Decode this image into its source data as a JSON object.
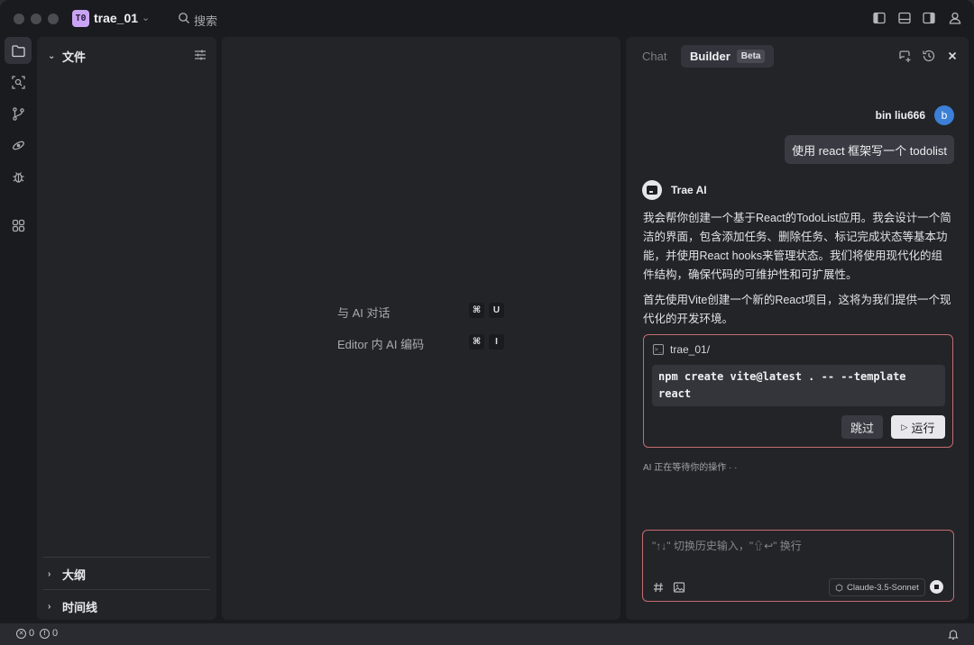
{
  "titlebar": {
    "project_badge": "T0",
    "project_name": "trae_01",
    "search_label": "搜索"
  },
  "activity_bar": {
    "items": [
      {
        "icon": "files-icon",
        "active": true
      },
      {
        "icon": "search-scan-icon",
        "active": false
      },
      {
        "icon": "source-control-icon",
        "active": false
      },
      {
        "icon": "remote-icon",
        "active": false
      },
      {
        "icon": "debug-icon",
        "active": false
      },
      {
        "icon": "extensions-icon",
        "active": false
      }
    ]
  },
  "files_panel": {
    "title": "文件",
    "outline_title": "大纲",
    "timeline_title": "时间线"
  },
  "editor": {
    "hints": [
      {
        "label": "与 AI 对话",
        "keys": [
          "⌘",
          "U"
        ]
      },
      {
        "label": "Editor 内 AI 编码",
        "keys": [
          "⌘",
          "I"
        ]
      }
    ]
  },
  "chat": {
    "tabs": {
      "chat": "Chat",
      "builder": "Builder",
      "beta": "Beta"
    },
    "user": {
      "name": "bin liu666",
      "avatar_letter": "b",
      "message": "使用 react 框架写一个 todolist"
    },
    "ai": {
      "name": "Trae AI",
      "paragraph1": "我会帮你创建一个基于React的TodoList应用。我会设计一个简洁的界面，包含添加任务、删除任务、标记完成状态等基本功能，并使用React hooks来管理状态。我们将使用现代化的组件结构，确保代码的可维护性和可扩展性。",
      "paragraph2": "首先使用Vite创建一个新的React项目，这将为我们提供一个现代化的开发环境。"
    },
    "command": {
      "path": "trae_01/",
      "line1": "npm create vite@latest . -- --template",
      "line2": "react",
      "skip_label": "跳过",
      "run_label": "运行"
    },
    "waiting_text": "AI 正在等待你的操作 · ·",
    "input": {
      "placeholder": "\"↑↓\" 切换历史输入，\"⇧↩\" 换行",
      "model": "Claude-3.5-Sonnet"
    }
  },
  "statusbar": {
    "errors": "0",
    "warnings": "0"
  },
  "colors": {
    "window_bg": "#1a1b1f",
    "panel_bg": "#232428",
    "accent_border": "#c46d70",
    "avatar_blue": "#3c7fd6",
    "project_badge": "#c9a3f5"
  }
}
